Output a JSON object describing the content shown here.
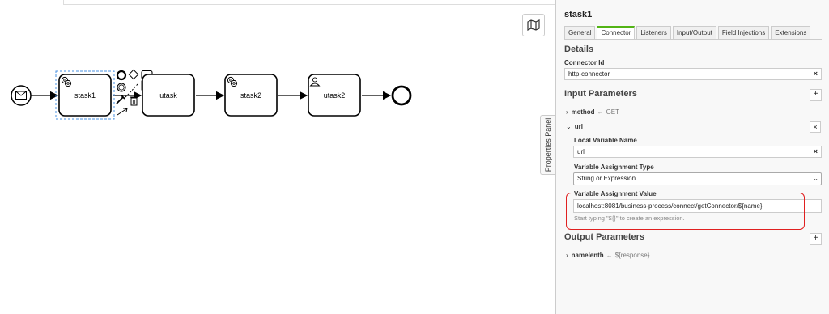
{
  "diagram": {
    "tasks": [
      {
        "label": "stask1",
        "type": "service"
      },
      {
        "label": "utask",
        "type": "plain"
      },
      {
        "label": "stask2",
        "type": "service"
      },
      {
        "label": "utask2",
        "type": "user"
      }
    ]
  },
  "panel": {
    "element_title": "stask1",
    "side_tab_label": "Properties Panel",
    "tabs": [
      "General",
      "Connector",
      "Listeners",
      "Input/Output",
      "Field Injections",
      "Extensions"
    ],
    "active_tab": "Connector",
    "details": {
      "title": "Details",
      "connector_id_label": "Connector Id",
      "connector_id_value": "http-connector"
    },
    "input_parameters": {
      "title": "Input Parameters",
      "method": {
        "name": "method",
        "value": "GET"
      },
      "url": {
        "name": "url",
        "local_variable_name_label": "Local Variable Name",
        "local_variable_name_value": "url",
        "assignment_type_label": "Variable Assignment Type",
        "assignment_type_value": "String or Expression",
        "assignment_value_label": "Variable Assignment Value",
        "assignment_value": "localhost:8081/business-process/connect/getConnector/${name}",
        "hint": "Start typing \"${}\" to create an expression."
      }
    },
    "output_parameters": {
      "title": "Output Parameters",
      "items": [
        {
          "name": "namelenth",
          "value": "${response}"
        }
      ]
    },
    "icons": {
      "remove": "×",
      "add": "+",
      "arrow": "←",
      "collapsed": "›",
      "expanded": "⌄",
      "select_caret": "⌄"
    }
  }
}
